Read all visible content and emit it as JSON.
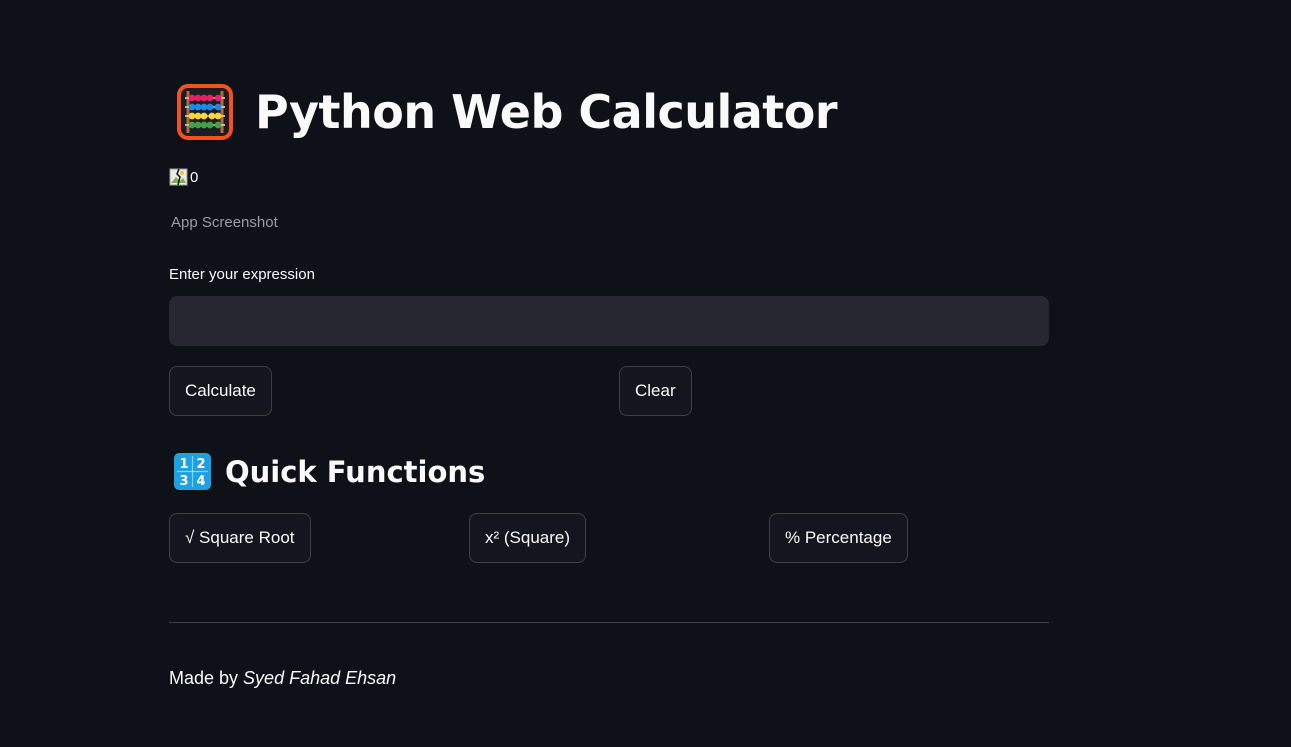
{
  "header": {
    "title": "Python Web Calculator",
    "icon": "abacus-icon"
  },
  "image": {
    "alt_text": "0",
    "caption": "App Screenshot",
    "icon": "broken-image-icon"
  },
  "expression": {
    "label": "Enter your expression",
    "value": "",
    "placeholder": ""
  },
  "actions": {
    "calculate_label": "Calculate",
    "clear_label": "Clear"
  },
  "quick_functions": {
    "title": "Quick Functions",
    "icon": "input-numbers-icon",
    "square_root_label": "√ Square Root",
    "square_label": "x² (Square)",
    "percentage_label": "% Percentage"
  },
  "footer": {
    "prefix": "Made by ",
    "author": "Syed Fahad Ehsan"
  },
  "colors": {
    "background": "#0e1117",
    "input_background": "#262730",
    "button_border": "#3d3f47",
    "text": "#fafafa",
    "caption_text": "#9a9ba3"
  }
}
